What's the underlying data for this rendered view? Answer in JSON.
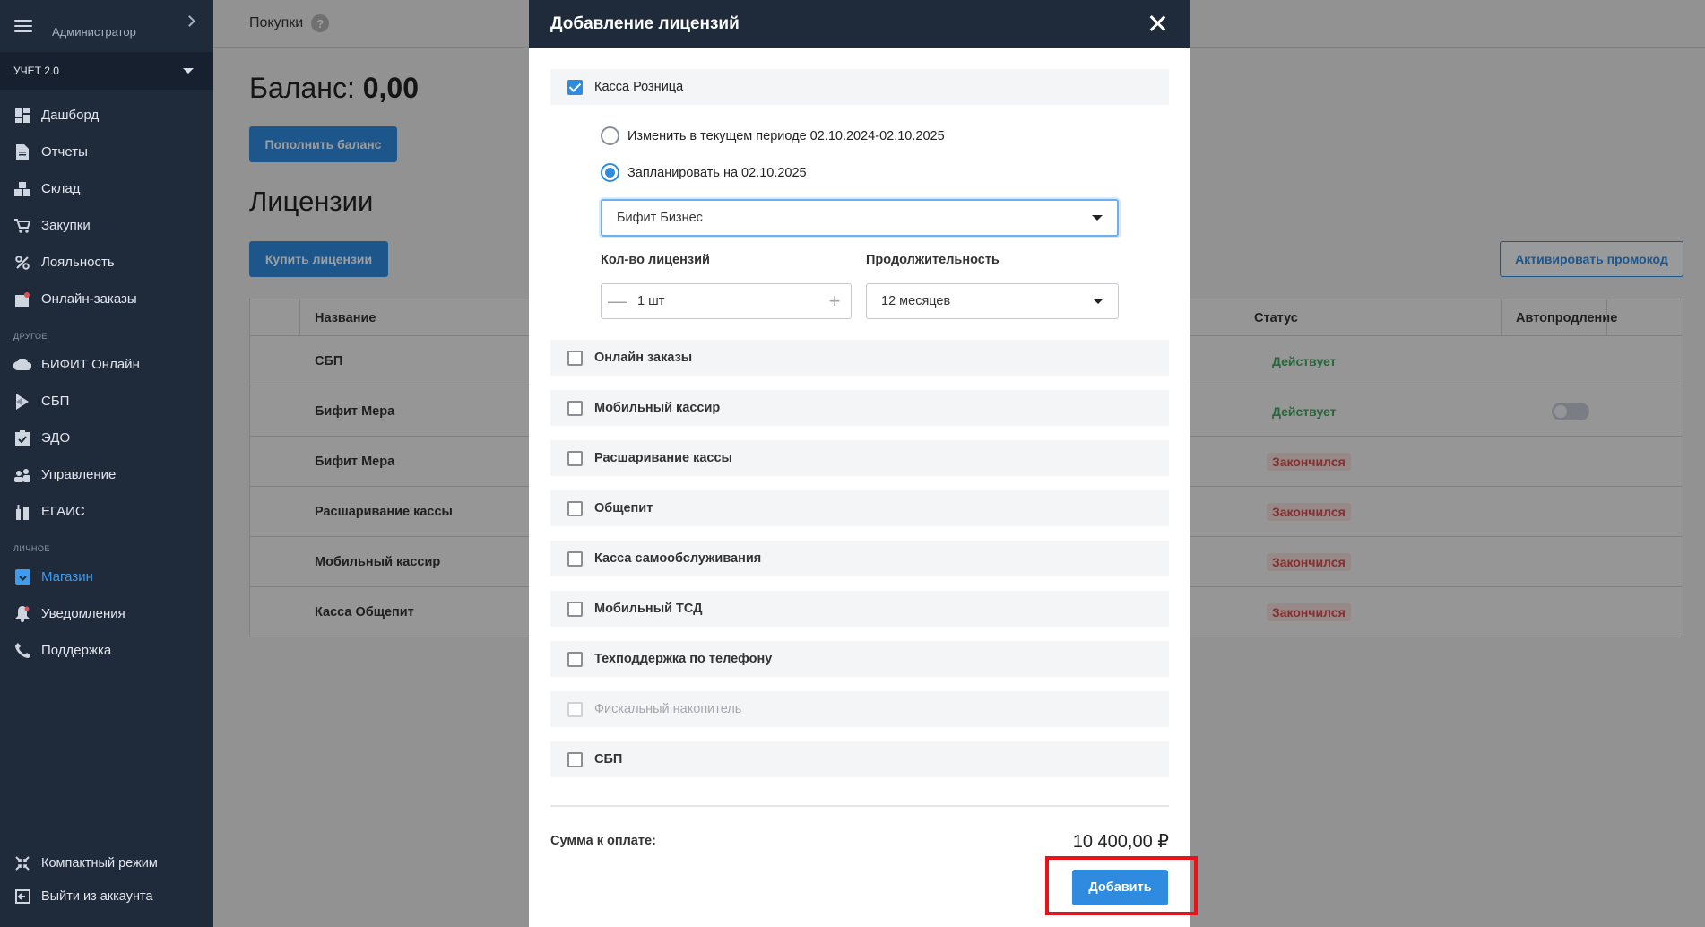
{
  "sidebar": {
    "admin": "Администратор",
    "org": "УЧЕТ 2.0",
    "items": [
      {
        "label": "Дашборд",
        "icon": "dashboard-icon"
      },
      {
        "label": "Отчеты",
        "icon": "document-icon"
      },
      {
        "label": "Склад",
        "icon": "warehouse-icon"
      },
      {
        "label": "Закупки",
        "icon": "cart-icon"
      },
      {
        "label": "Лояльность",
        "icon": "percent-icon"
      },
      {
        "label": "Онлайн-заказы",
        "icon": "online-orders-icon"
      }
    ],
    "section_other": "ДРУГОЕ",
    "other_items": [
      {
        "label": "БИФИТ Онлайн",
        "icon": "cloud-icon"
      },
      {
        "label": "СБП",
        "icon": "sbp-icon"
      },
      {
        "label": "ЭДО",
        "icon": "edo-icon"
      },
      {
        "label": "Управление",
        "icon": "management-icon"
      },
      {
        "label": "ЕГАИС",
        "icon": "egais-icon"
      }
    ],
    "section_personal": "ЛИЧНОЕ",
    "personal_items": [
      {
        "label": "Магазин",
        "icon": "store-icon",
        "active": true
      },
      {
        "label": "Уведомления",
        "icon": "bell-icon"
      },
      {
        "label": "Поддержка",
        "icon": "phone-icon"
      }
    ],
    "bottom_items": [
      {
        "label": "Компактный режим",
        "icon": "compact-icon"
      },
      {
        "label": "Выйти из аккаунта",
        "icon": "logout-icon"
      }
    ]
  },
  "header": {
    "title": "Покупки",
    "help": "?"
  },
  "balance": {
    "label": "Баланс:",
    "value": "0,00"
  },
  "topup_button": "Пополнить баланс",
  "licenses": {
    "title": "Лицензии",
    "buy_button": "Купить лицензии",
    "promo_button": "Активировать промокод",
    "columns": {
      "name": "Название",
      "status": "Статус",
      "autorenew": "Автопродление"
    },
    "rows": [
      {
        "name": "СБП",
        "status": "Действует",
        "ok": true
      },
      {
        "name": "Бифит Мера",
        "status": "Действует",
        "ok": true,
        "toggle": true
      },
      {
        "name": "Бифит Мера",
        "status": "Закончился",
        "ok": false
      },
      {
        "name": "Расшаривание кассы",
        "status": "Закончился",
        "ok": false
      },
      {
        "name": "Мобильный кассир",
        "status": "Закончился",
        "ok": false
      },
      {
        "name": "Касса Общепит",
        "status": "Закончился",
        "ok": false
      }
    ]
  },
  "modal": {
    "title": "Добавление лицензий",
    "main_option": {
      "label": "Касса Розница",
      "checked": true
    },
    "radio_change": "Изменить в текущем периоде 02.10.2024-02.10.2025",
    "radio_schedule": "Запланировать на 02.10.2025",
    "tariff_select": "Бифит Бизнес",
    "qty_label": "Кол-во лицензий",
    "qty_value": "1 шт",
    "duration_label": "Продолжительность",
    "duration_value": "12 месяцев",
    "options": [
      {
        "label": "Онлайн заказы",
        "disabled": false
      },
      {
        "label": "Мобильный кассир",
        "disabled": false
      },
      {
        "label": "Расшаривание кассы",
        "disabled": false
      },
      {
        "label": "Общепит",
        "disabled": false
      },
      {
        "label": "Касса самообслуживания",
        "disabled": false
      },
      {
        "label": "Мобильный ТСД",
        "disabled": false
      },
      {
        "label": "Техподдержка по телефону",
        "disabled": false
      },
      {
        "label": "Фискальный накопитель",
        "disabled": true
      },
      {
        "label": "СБП",
        "disabled": false
      }
    ],
    "sum_label": "Сумма к оплате:",
    "sum_value": "10 400,00 ₽",
    "add_button": "Добавить"
  },
  "colors": {
    "accent": "#2f8be0",
    "sidebar": "#1f2a3b",
    "ok": "#3fa65f",
    "expired": "#d84a4a",
    "highlight": "#e8131a"
  }
}
